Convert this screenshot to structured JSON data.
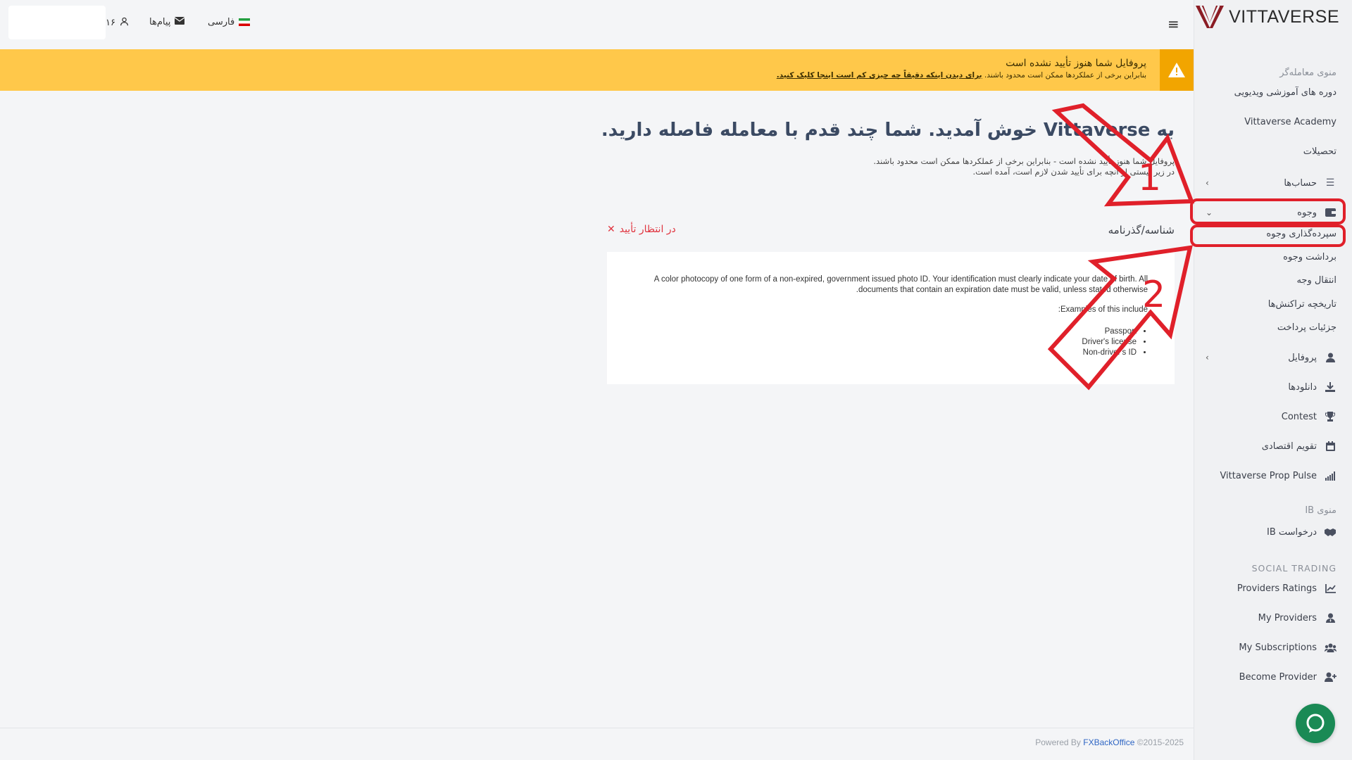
{
  "brand": {
    "name": "VITTAVERSE"
  },
  "topbar": {
    "language": "فارسی",
    "messages": "پیام‌ها",
    "user": "۱۶"
  },
  "banner": {
    "title": "پروفایل شما هنوز تأیید نشده است",
    "subtitle": "بنابراین برخی از عملکردها ممکن است محدود باشند.",
    "link": "برای دیدن اینکه دقیقاً چه چیزی کم است اینجا کلیک کنید."
  },
  "main": {
    "title": "به Vittaverse خوش آمدید. شما چند قدم با معامله فاصله دارید.",
    "desc_line1": "پروفایل شما هنوز تأیید نشده است - بنابراین برخی از عملکردها ممکن است محدود باشند.",
    "desc_line2": "در زیر لیستی از آنچه برای تأیید شدن لازم است، آمده است.",
    "section_title": "شناسه/گذرنامه",
    "status": "در انتظار تأیید",
    "card_text": "A color photocopy of one form of a non-expired, government issued photo ID. Your identification must clearly indicate your date of birth. All documents that contain an expiration date must be valid, unless stated otherwise.",
    "card_examples": "Examples of this include:",
    "card_list": [
      "Passport",
      "Driver's license",
      "Non-driver's ID"
    ]
  },
  "sidebar": {
    "trader_menu": "منوی معامله‌گر",
    "items": {
      "video_courses": "دوره های آموزشی ویدیویی",
      "academy": "Vittaverse Academy",
      "education": "تحصیلات",
      "accounts": "حساب‌ها",
      "funds": "وجوه",
      "deposit": "سپرده‌گذاری وجوه",
      "withdraw": "برداشت وجوه",
      "transfer": "انتقال وجه",
      "history": "تاریخچه تراکنش‌ها",
      "payment_details": "جزئیات پرداخت",
      "profile": "پروفایل",
      "downloads": "دانلودها",
      "contest": "Contest",
      "calendar": "تقویم اقتصادی",
      "prop_pulse": "Vittaverse Prop Pulse"
    },
    "ib_menu": "منوی IB",
    "ib_request": "درخواست IB",
    "social_trading": "SOCIAL TRADING",
    "social": {
      "ratings": "Providers Ratings",
      "my_providers": "My Providers",
      "subscriptions": "My Subscriptions",
      "become": "Become Provider"
    }
  },
  "footer": {
    "powered": "Powered By",
    "company": "FXBackOffice",
    "copyright": "©2015-2025"
  },
  "annotations": {
    "step1": "1",
    "step2": "2"
  },
  "colors": {
    "banner": "#ffc84a",
    "annotation": "#e0202a",
    "chat": "#1a8a55",
    "link": "#2f66c4"
  }
}
